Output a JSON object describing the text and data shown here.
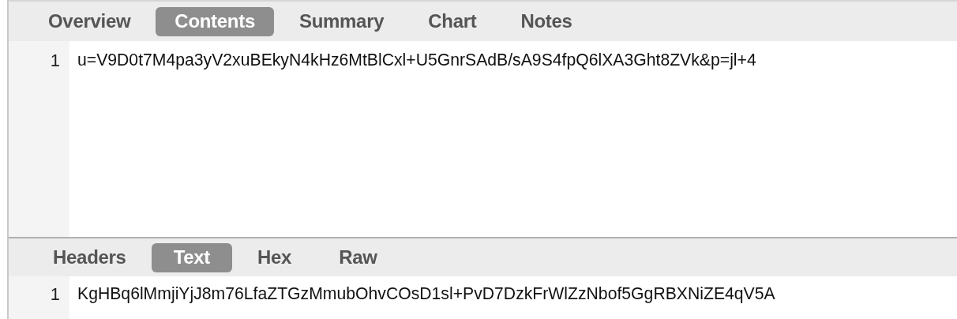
{
  "top_pane": {
    "tabs": [
      {
        "label": "Overview",
        "selected": false
      },
      {
        "label": "Contents",
        "selected": true
      },
      {
        "label": "Summary",
        "selected": false
      },
      {
        "label": "Chart",
        "selected": false
      },
      {
        "label": "Notes",
        "selected": false
      }
    ],
    "lines": [
      {
        "number": "1",
        "text": "u=V9D0t7M4pa3yV2xuBEkyN4kHz6MtBlCxl+U5GnrSAdB/sA9S4fpQ6lXA3Ght8ZVk&p=jl+4"
      }
    ]
  },
  "bottom_pane": {
    "tabs": [
      {
        "label": "Headers",
        "selected": false
      },
      {
        "label": "Text",
        "selected": true
      },
      {
        "label": "Hex",
        "selected": false
      },
      {
        "label": "Raw",
        "selected": false
      }
    ],
    "lines": [
      {
        "number": "1",
        "text": "KgHBq6lMmjiYjJ8m76LfaZTGzMmubOhvCOsD1sl+PvD7DzkFrWlZzNbof5GgRBXNiZE4qV5A"
      }
    ]
  }
}
